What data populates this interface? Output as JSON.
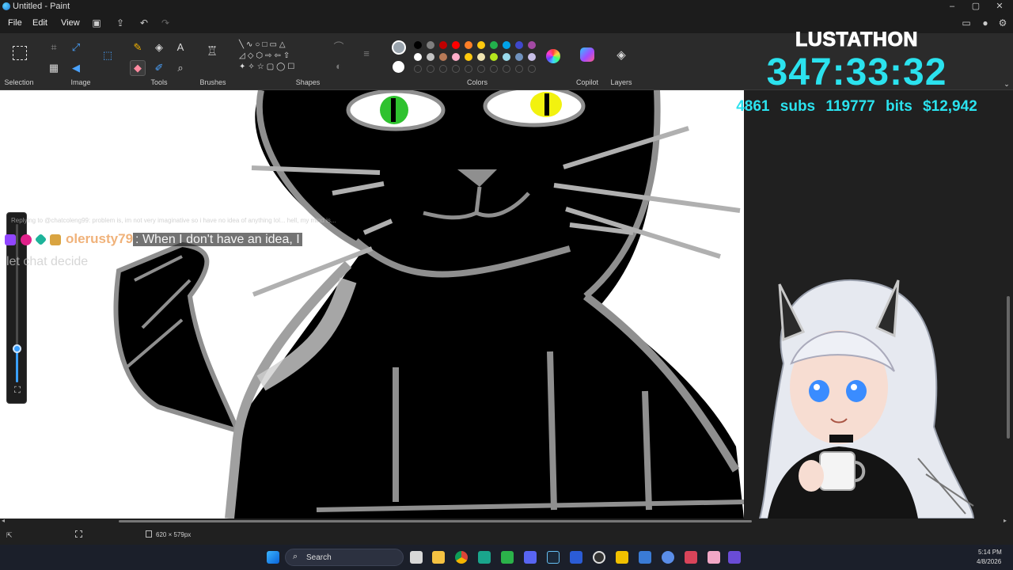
{
  "window": {
    "title": "Untitled - Paint",
    "controls": [
      "–",
      "▢",
      "✕"
    ]
  },
  "menu": {
    "items": [
      "File",
      "Edit",
      "View"
    ]
  },
  "ribbon": {
    "groups": {
      "selection": "Selection",
      "image": "Image",
      "tools": "Tools",
      "brushes": "Brushes",
      "shapes": "Shapes",
      "colors": "Colors",
      "copilot": "Copilot",
      "layers": "Layers"
    },
    "colors": {
      "primary": "#9aa4ad",
      "secondary": "#ffffff",
      "row1": [
        "#000000",
        "#7f7f7f",
        "#c00000",
        "#ff0000",
        "#ff7f27",
        "#ffc90e",
        "#22b14c",
        "#00a2e8",
        "#3f48cc",
        "#a349a4"
      ],
      "row2": [
        "#ffffff",
        "#c3c3c3",
        "#b97a57",
        "#ffaec9",
        "#ffc90e",
        "#efe4b0",
        "#b5e61d",
        "#99d9ea",
        "#7092be",
        "#c8bfe7"
      ]
    }
  },
  "overlay": {
    "title": "LUSTATHON",
    "timer": "347:33:32",
    "stats": "4861 subs   119777 bits   $12,942"
  },
  "chat": {
    "reply_context": "Replying to @chatcoleng99: problem is, im not very imaginative so i have no idea of anything lol... hell, my mind is...",
    "username": "olerusty79",
    "message_part1": ": When I don't have an idea, I",
    "message_part2": "let chat decide"
  },
  "status": {
    "canvas_size": "620 × 579px"
  },
  "taskbar": {
    "search_placeholder": "Search",
    "time": "5:14 PM",
    "date": "4/8/2026"
  }
}
